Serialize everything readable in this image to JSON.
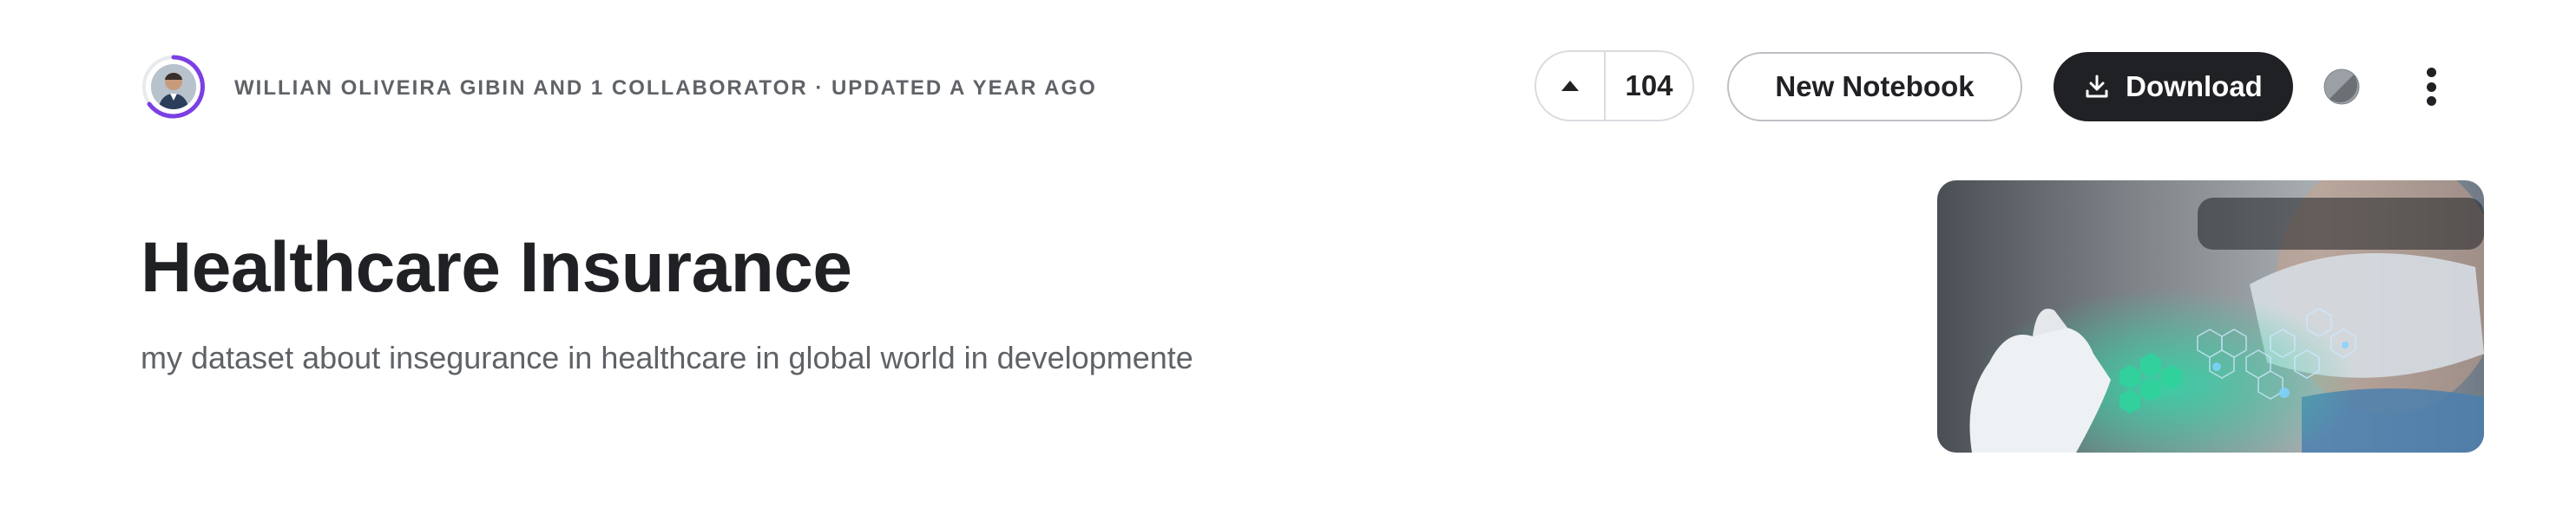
{
  "header": {
    "meta_text": "WILLIAN OLIVEIRA GIBIN AND 1 COLLABORATOR · UPDATED A YEAR AGO",
    "avatar_icon": "user-avatar",
    "ring_color": "#7b3fe4"
  },
  "actions": {
    "upvote_icon": "triangle-up-icon",
    "vote_count": "104",
    "new_notebook_label": "New Notebook",
    "download_label": "Download",
    "download_icon": "download-icon",
    "theme_icon": "half-circle-icon",
    "more_icon": "vertical-dots-icon",
    "accent_dark": "#202124"
  },
  "dataset": {
    "title": "Healthcare Insurance",
    "subtitle": "my dataset about insegurance in healthcare in global world in developmente",
    "cover_image": "healthcare-hexagon-photo"
  }
}
